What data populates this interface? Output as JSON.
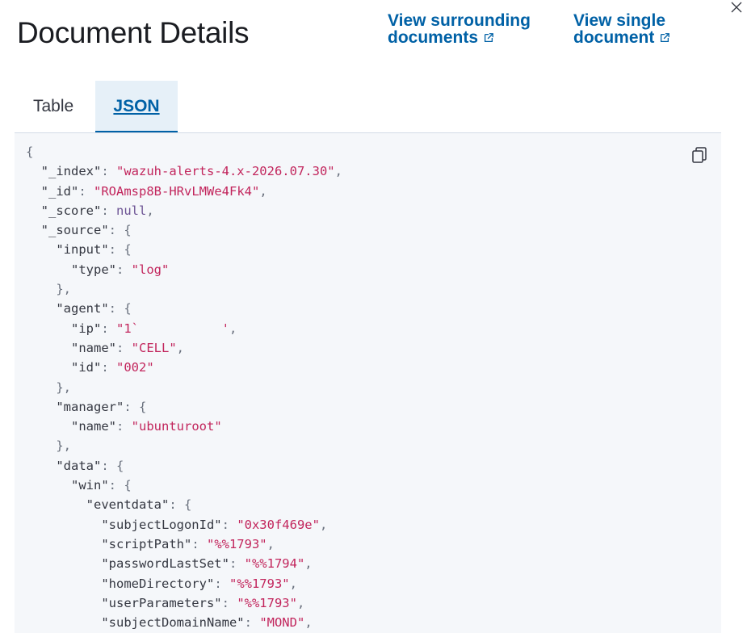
{
  "header": {
    "title": "Document Details",
    "link_surrounding": [
      "View surrounding",
      "documents"
    ],
    "link_single": [
      "View single",
      "document"
    ]
  },
  "tabs": [
    {
      "label": "Table",
      "active": false
    },
    {
      "label": "JSON",
      "active": true
    }
  ],
  "icons": {
    "close": "close-icon",
    "copy": "copy-icon",
    "external": "external-link-icon"
  },
  "colors": {
    "link": "#0061a6",
    "active_tab_bg": "#e6f0f8",
    "code_bg": "#f5f7fa",
    "json_string": "#c2255c",
    "json_null": "#6c5394"
  },
  "json_lines": [
    {
      "indent": 0,
      "tokens": [
        {
          "t": "p",
          "v": "{"
        }
      ]
    },
    {
      "indent": 1,
      "tokens": [
        {
          "t": "k",
          "v": "\"_index\""
        },
        {
          "t": "p",
          "v": ": "
        },
        {
          "t": "s",
          "v": "\"wazuh-alerts-4.x-2026.07.30\""
        },
        {
          "t": "p",
          "v": ","
        }
      ]
    },
    {
      "indent": 1,
      "tokens": [
        {
          "t": "k",
          "v": "\"_id\""
        },
        {
          "t": "p",
          "v": ": "
        },
        {
          "t": "s",
          "v": "\"ROAmsp8B-HRvLMWe4Fk4\""
        },
        {
          "t": "p",
          "v": ","
        }
      ]
    },
    {
      "indent": 1,
      "tokens": [
        {
          "t": "k",
          "v": "\"_score\""
        },
        {
          "t": "p",
          "v": ": "
        },
        {
          "t": "n",
          "v": "null"
        },
        {
          "t": "p",
          "v": ","
        }
      ]
    },
    {
      "indent": 1,
      "tokens": [
        {
          "t": "k",
          "v": "\"_source\""
        },
        {
          "t": "p",
          "v": ": {"
        }
      ]
    },
    {
      "indent": 2,
      "tokens": [
        {
          "t": "k",
          "v": "\"input\""
        },
        {
          "t": "p",
          "v": ": {"
        }
      ]
    },
    {
      "indent": 3,
      "tokens": [
        {
          "t": "k",
          "v": "\"type\""
        },
        {
          "t": "p",
          "v": ": "
        },
        {
          "t": "s",
          "v": "\"log\""
        }
      ]
    },
    {
      "indent": 2,
      "tokens": [
        {
          "t": "p",
          "v": "},"
        }
      ]
    },
    {
      "indent": 2,
      "tokens": [
        {
          "t": "k",
          "v": "\"agent\""
        },
        {
          "t": "p",
          "v": ": {"
        }
      ]
    },
    {
      "indent": 3,
      "tokens": [
        {
          "t": "k",
          "v": "\"ip\""
        },
        {
          "t": "p",
          "v": ": "
        },
        {
          "t": "s",
          "v": "\"1`           '"
        },
        {
          "t": "p",
          "v": ","
        }
      ]
    },
    {
      "indent": 3,
      "tokens": [
        {
          "t": "k",
          "v": "\"name\""
        },
        {
          "t": "p",
          "v": ": "
        },
        {
          "t": "s",
          "v": "\"CELL\""
        },
        {
          "t": "p",
          "v": ","
        }
      ]
    },
    {
      "indent": 3,
      "tokens": [
        {
          "t": "k",
          "v": "\"id\""
        },
        {
          "t": "p",
          "v": ": "
        },
        {
          "t": "s",
          "v": "\"002\""
        }
      ]
    },
    {
      "indent": 2,
      "tokens": [
        {
          "t": "p",
          "v": "},"
        }
      ]
    },
    {
      "indent": 2,
      "tokens": [
        {
          "t": "k",
          "v": "\"manager\""
        },
        {
          "t": "p",
          "v": ": {"
        }
      ]
    },
    {
      "indent": 3,
      "tokens": [
        {
          "t": "k",
          "v": "\"name\""
        },
        {
          "t": "p",
          "v": ": "
        },
        {
          "t": "s",
          "v": "\"ubunturoot\""
        }
      ]
    },
    {
      "indent": 2,
      "tokens": [
        {
          "t": "p",
          "v": "},"
        }
      ]
    },
    {
      "indent": 2,
      "tokens": [
        {
          "t": "k",
          "v": "\"data\""
        },
        {
          "t": "p",
          "v": ": {"
        }
      ]
    },
    {
      "indent": 3,
      "tokens": [
        {
          "t": "k",
          "v": "\"win\""
        },
        {
          "t": "p",
          "v": ": {"
        }
      ]
    },
    {
      "indent": 4,
      "tokens": [
        {
          "t": "k",
          "v": "\"eventdata\""
        },
        {
          "t": "p",
          "v": ": {"
        }
      ]
    },
    {
      "indent": 5,
      "tokens": [
        {
          "t": "k",
          "v": "\"subjectLogonId\""
        },
        {
          "t": "p",
          "v": ": "
        },
        {
          "t": "s",
          "v": "\"0x30f469e\""
        },
        {
          "t": "p",
          "v": ","
        }
      ]
    },
    {
      "indent": 5,
      "tokens": [
        {
          "t": "k",
          "v": "\"scriptPath\""
        },
        {
          "t": "p",
          "v": ": "
        },
        {
          "t": "s",
          "v": "\"%%1793\""
        },
        {
          "t": "p",
          "v": ","
        }
      ]
    },
    {
      "indent": 5,
      "tokens": [
        {
          "t": "k",
          "v": "\"passwordLastSet\""
        },
        {
          "t": "p",
          "v": ": "
        },
        {
          "t": "s",
          "v": "\"%%1794\""
        },
        {
          "t": "p",
          "v": ","
        }
      ]
    },
    {
      "indent": 5,
      "tokens": [
        {
          "t": "k",
          "v": "\"homeDirectory\""
        },
        {
          "t": "p",
          "v": ": "
        },
        {
          "t": "s",
          "v": "\"%%1793\""
        },
        {
          "t": "p",
          "v": ","
        }
      ]
    },
    {
      "indent": 5,
      "tokens": [
        {
          "t": "k",
          "v": "\"userParameters\""
        },
        {
          "t": "p",
          "v": ": "
        },
        {
          "t": "s",
          "v": "\"%%1793\""
        },
        {
          "t": "p",
          "v": ","
        }
      ]
    },
    {
      "indent": 5,
      "tokens": [
        {
          "t": "k",
          "v": "\"subjectDomainName\""
        },
        {
          "t": "p",
          "v": ": "
        },
        {
          "t": "s",
          "v": "\"MOND\""
        },
        {
          "t": "p",
          "v": ","
        }
      ]
    }
  ]
}
